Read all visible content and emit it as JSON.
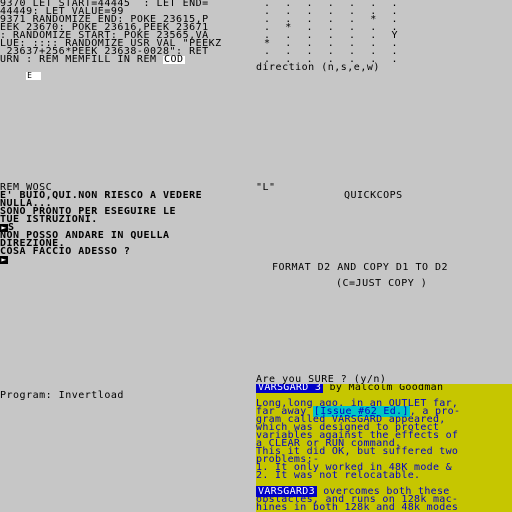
{
  "basic_listing": [
    "9370 LET START=44445  : LET END=",
    "44449: LET VALUE=99",
    "9371 RANDOMIZE END: POKE 23615,P",
    "EEK 23670: POKE 23616,PEEK 23671",
    ": RANDOMIZE START: POKE 23565,VA",
    "LUE: :::: RANDOMIZE USR VAL \"PEEKZ",
    " 23637+256*PEEK 23638-0028\": RET",
    "URN : REM MEMFILL IN REM "
  ],
  "cod_label": "COD",
  "cursor_e": "E",
  "direction_prompt": "direction (n,s,e,w)",
  "dot_grid": [
    ". . . . . . .",
    ". . . . . . .",
    ". . . . . * .",
    ". * . . . . .",
    ". . . . . . Y",
    "* . . . . . .",
    ". . . . . . .",
    ". . . . . . ."
  ],
  "rem_line": "REM WOSC",
  "quote_l": "\"L\"",
  "quickcops": "QUICKCOPS",
  "adventure_lines": [
    "E' BUIO,QUI.NON RIESCO A VEDERE",
    "NULLA...",
    "SONO PRONTO PER ESEGUIRE LE",
    "TUE ISTRUZIONI.",
    "S",
    "NON POSSO ANDARE IN QUELLA",
    "DIREZIONE.",
    "COSA FACCIO ADESSO ?",
    ""
  ],
  "format_line": "FORMAT D2 AND COPY D1 TO D2",
  "format_hint": "(C=JUST COPY )",
  "sure_prompt": "Are you SURE ? (y/n)",
  "program_line": "Program: Invertload",
  "article": {
    "title_tag": "VARSGARD 3",
    "byline": "by Malcolm Goodman",
    "issue_tag": "[Issue #62 Ed.]",
    "body_lines_pre_issue": [
      "Long,long ago, in an OUTLET far,",
      "far away "
    ],
    "after_issue": ", a pro-",
    "body_lines": [
      "gram called VARSGARD appeared,",
      "which was designed to protect",
      "variables against the effects of",
      "a CLEAR or RUN command.",
      "This it did OK, but suffered two",
      "problems:-",
      "1. It only worked in 48K mode &",
      "2. It was not relocatable."
    ],
    "tag2": "VARSGARD3",
    "tail_lines": [
      " overcomes both these",
      "obstacles, and runs on 128k mac-",
      "hines in both 128k and 48k modes"
    ]
  }
}
